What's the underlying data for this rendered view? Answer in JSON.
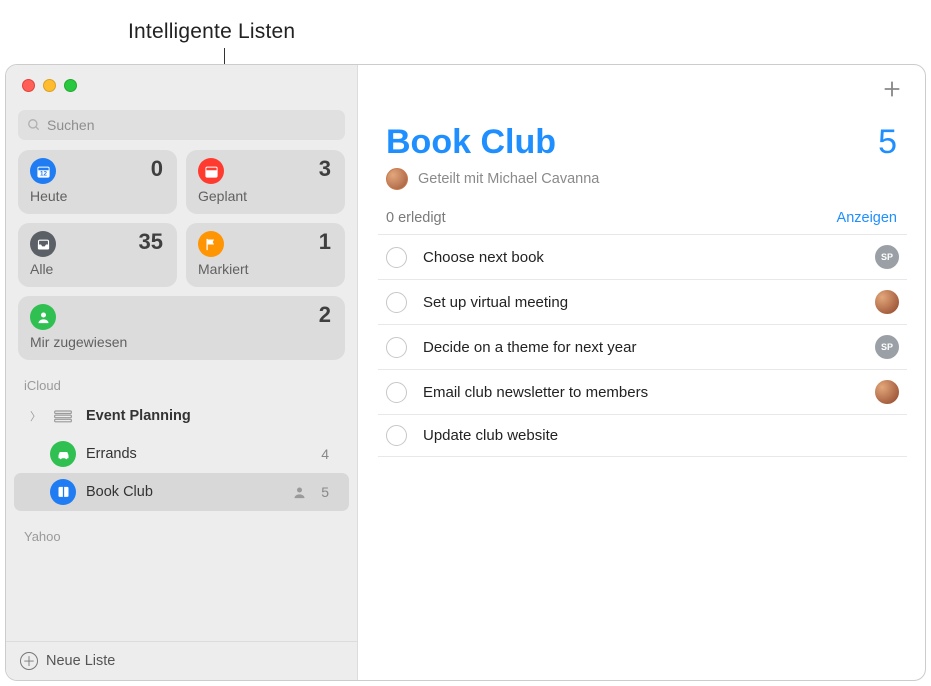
{
  "annotation": "Intelligente Listen",
  "search": {
    "placeholder": "Suchen"
  },
  "smart": [
    {
      "icon": "calendar-today",
      "color": "sc-blue",
      "label": "Heute",
      "count": 0
    },
    {
      "icon": "calendar",
      "color": "sc-red",
      "label": "Geplant",
      "count": 3
    },
    {
      "icon": "tray",
      "color": "sc-grey",
      "label": "Alle",
      "count": 35
    },
    {
      "icon": "flag",
      "color": "sc-orange",
      "label": "Markiert",
      "count": 1
    },
    {
      "icon": "person",
      "color": "sc-green",
      "label": "Mir zugewiesen",
      "count": 2,
      "wide": true
    }
  ],
  "accounts": [
    {
      "name": "iCloud",
      "lists": [
        {
          "name": "Event Planning",
          "icon": "group",
          "bold": true,
          "expandable": true
        },
        {
          "name": "Errands",
          "icon": "car",
          "color": "sc-green",
          "count": 4
        },
        {
          "name": "Book Club",
          "icon": "book",
          "color": "sc-blue",
          "count": 5,
          "shared": true,
          "selected": true
        }
      ]
    },
    {
      "name": "Yahoo",
      "lists": []
    }
  ],
  "footer": {
    "new_list": "Neue Liste"
  },
  "main": {
    "title": "Book Club",
    "count": 5,
    "shared_with_prefix": "Geteilt mit",
    "shared_with_name": "Michael Cavanna",
    "completed_text": "0 erledigt",
    "show_label": "Anzeigen",
    "tasks": [
      {
        "title": "Choose next book",
        "assignee": {
          "type": "initials",
          "text": "SP"
        }
      },
      {
        "title": "Set up virtual meeting",
        "assignee": {
          "type": "photo"
        }
      },
      {
        "title": "Decide on a theme for next year",
        "assignee": {
          "type": "initials",
          "text": "SP"
        }
      },
      {
        "title": "Email club newsletter to members",
        "assignee": {
          "type": "photo"
        }
      },
      {
        "title": "Update club website"
      }
    ]
  }
}
